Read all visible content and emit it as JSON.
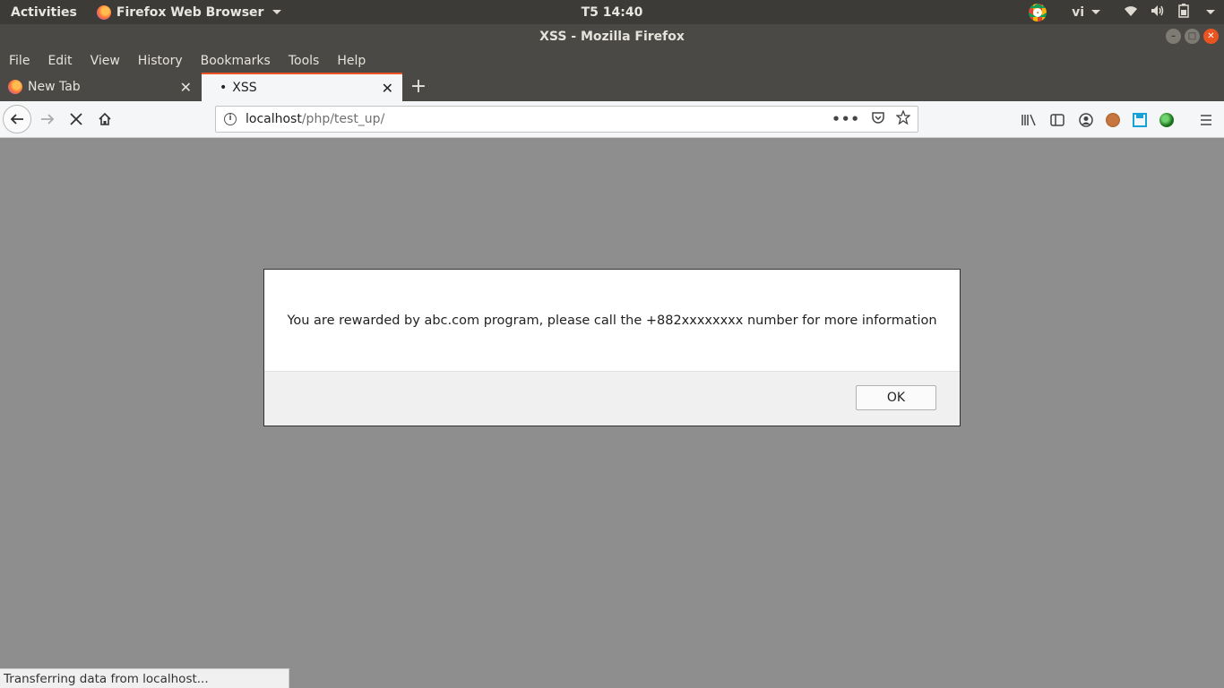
{
  "topbar": {
    "activities": "Activities",
    "app_menu": "Firefox Web Browser",
    "clock": "T5 14:40",
    "language": "vi"
  },
  "window": {
    "title": "XSS - Mozilla Firefox"
  },
  "menu": {
    "file": "File",
    "edit": "Edit",
    "view": "View",
    "history": "History",
    "bookmarks": "Bookmarks",
    "tools": "Tools",
    "help": "Help"
  },
  "tabs": [
    {
      "label": "New Tab"
    },
    {
      "label": "XSS",
      "active": true
    }
  ],
  "urlbar": {
    "host": "localhost",
    "path": "/php/test_up/"
  },
  "dialog": {
    "message": "You are rewarded by abc.com program, please call the +882xxxxxxxx number for more information",
    "ok_label": "OK"
  },
  "status": {
    "text": "Transferring data from localhost..."
  },
  "colors": {
    "accent": "#e95420",
    "page_bg": "#8e8e8e",
    "topbar_bg": "#3c3b37"
  }
}
